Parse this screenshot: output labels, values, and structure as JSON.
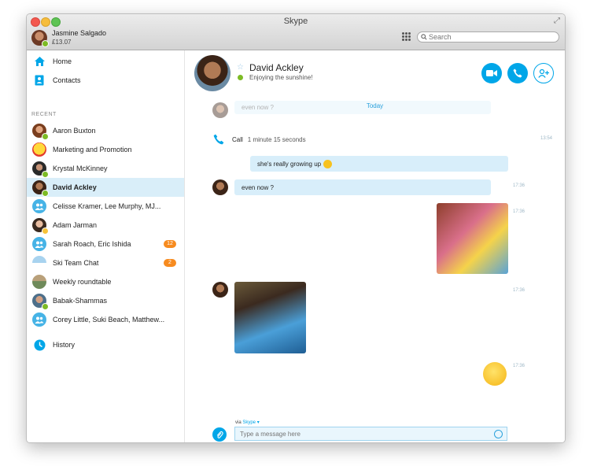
{
  "window": {
    "title": "Skype"
  },
  "account": {
    "name": "Jasmine Salgado",
    "credit": "£13.07"
  },
  "search": {
    "placeholder": "Search"
  },
  "nav": {
    "home": "Home",
    "contacts": "Contacts",
    "history": "History"
  },
  "recent_label": "RECENT",
  "contacts": [
    {
      "name": "Aaron Buxton",
      "presence": "online"
    },
    {
      "name": "Marketing and Promotion",
      "presence": "none"
    },
    {
      "name": "Krystal McKinney",
      "presence": "online"
    },
    {
      "name": "David Ackley",
      "presence": "online",
      "selected": true
    },
    {
      "name": "Celisse Kramer, Lee Murphy, MJ...",
      "presence": "group"
    },
    {
      "name": "Adam Jarman",
      "presence": "away"
    },
    {
      "name": "Sarah Roach, Eric Ishida",
      "presence": "group",
      "badge": "12"
    },
    {
      "name": "Ski Team Chat",
      "presence": "none",
      "badge": "2"
    },
    {
      "name": "Weekly roundtable",
      "presence": "none"
    },
    {
      "name": "Babak-Shammas",
      "presence": "online"
    },
    {
      "name": "Corey Little, Suki Beach, Matthew...",
      "presence": "group"
    }
  ],
  "conversation": {
    "name": "David Ackley",
    "mood": "Enjoying the sunshine!",
    "date_separator": "Today",
    "faded_message": "even now ?",
    "call": {
      "label": "Call",
      "duration": "1 minute 15 seconds",
      "time": "13:54"
    },
    "messages": [
      {
        "text": "she's really growing up",
        "time": ""
      },
      {
        "text": "even now ?",
        "time": "17:36"
      }
    ],
    "photo_time_1": "17:36",
    "photo_time_2": "17:36",
    "emoticon_time": "17:36"
  },
  "composer": {
    "via_prefix": "via",
    "via_service": "Skype",
    "placeholder": "Type a message here"
  },
  "colors": {
    "accent": "#00a6e8",
    "bubble": "#d8eefa",
    "badge": "#f78b1f",
    "online": "#7dbb25",
    "away": "#f6c23a"
  }
}
